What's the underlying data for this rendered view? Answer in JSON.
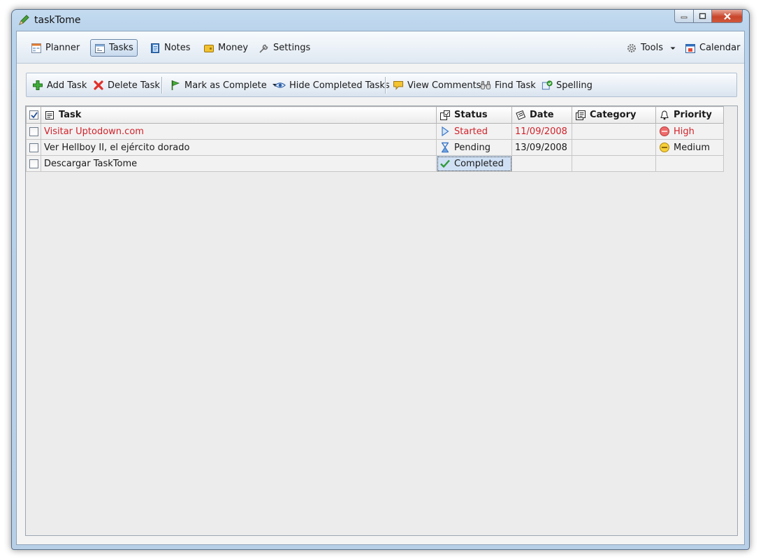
{
  "window": {
    "title": "taskTome",
    "controls": {
      "minimize_icon": "minimize-icon",
      "maximize_icon": "maximize-icon",
      "close_icon": "close-icon"
    }
  },
  "nav": {
    "items": [
      {
        "label": "Planner",
        "icon": "planner-icon",
        "active": false
      },
      {
        "label": "Tasks",
        "icon": "tasks-icon",
        "active": true
      },
      {
        "label": "Notes",
        "icon": "notes-icon",
        "active": false
      },
      {
        "label": "Money",
        "icon": "money-icon",
        "active": false
      },
      {
        "label": "Settings",
        "icon": "wrench-icon",
        "active": false
      }
    ],
    "right": [
      {
        "label": "Tools",
        "icon": "gear-icon",
        "has_dropdown": true
      },
      {
        "label": "Calendar",
        "icon": "calendar-icon"
      }
    ]
  },
  "toolbar": {
    "add_task": "Add Task",
    "delete_task": "Delete Task",
    "mark_complete": "Mark as Complete",
    "hide_completed": "Hide Completed Tasks",
    "view_comments": "View Comments",
    "find_task": "Find Task",
    "spelling": "Spelling"
  },
  "table": {
    "columns": {
      "task": "Task",
      "status": "Status",
      "date": "Date",
      "category": "Category",
      "priority": "Priority"
    },
    "header_checked": true,
    "rows": [
      {
        "checked": false,
        "task": "Visitar Uptodown.com",
        "status": "Started",
        "status_icon": "play-icon",
        "date": "11/09/2008",
        "category": "",
        "priority": "High",
        "priority_icon": "high-priority-icon",
        "overdue": true
      },
      {
        "checked": false,
        "task": "Ver Hellboy II, el ejército dorado",
        "status": "Pending",
        "status_icon": "hourglass-icon",
        "date": "13/09/2008",
        "category": "",
        "priority": "Medium",
        "priority_icon": "medium-priority-icon",
        "overdue": false
      },
      {
        "checked": false,
        "task": "Descargar TaskTome",
        "status": "Completed",
        "status_icon": "checkmark-icon",
        "date": "",
        "category": "",
        "priority": "",
        "priority_icon": "",
        "overdue": false
      }
    ]
  },
  "colors": {
    "overdue_text": "#d2222a",
    "frame_blue": "#b9d3ec",
    "selection": "#cfe0f4"
  }
}
